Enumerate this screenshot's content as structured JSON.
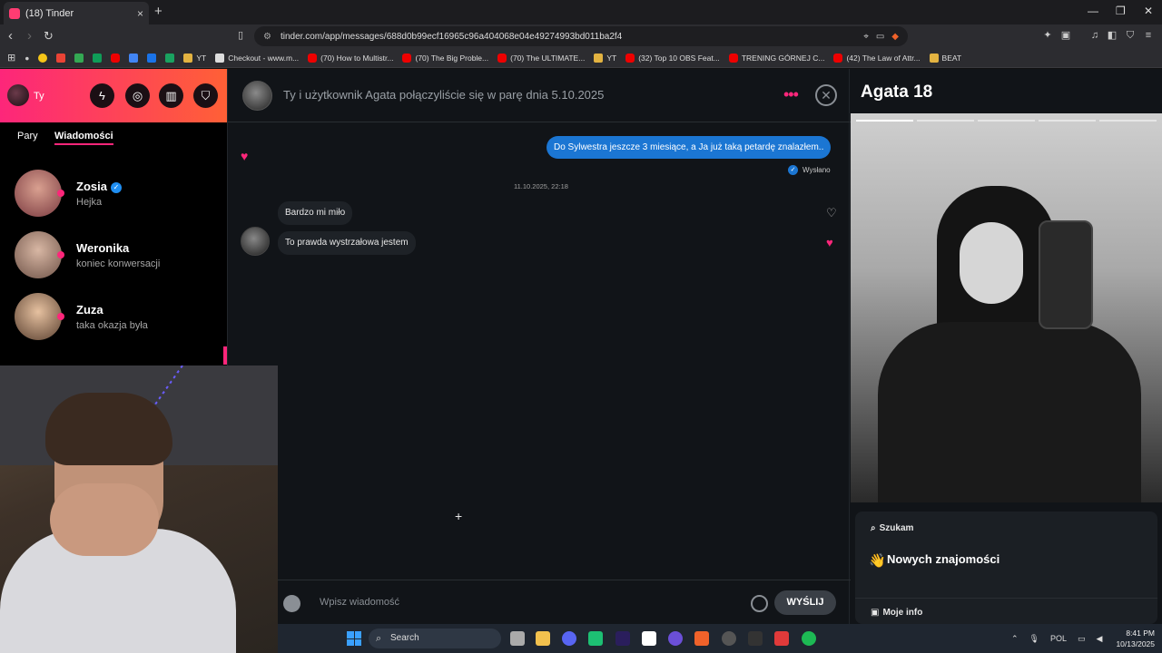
{
  "browser": {
    "tab_title": "(18) Tinder",
    "tab_close": "×",
    "new_tab": "+",
    "url": "tinder.com/app/messages/688d0b99ecf16965c96a404068e04e49274993bd011ba2f4",
    "bookmarks": [
      {
        "label": "YT",
        "icon": "folder"
      },
      {
        "label": "Checkout - www.m...",
        "icon": "page"
      },
      {
        "label": "(70) How to Multistr...",
        "icon": "youtube"
      },
      {
        "label": "(70) The Big Proble...",
        "icon": "youtube"
      },
      {
        "label": "(70) The ULTIMATE...",
        "icon": "youtube"
      },
      {
        "label": "YT",
        "icon": "folder"
      },
      {
        "label": "(32) Top 10 OBS Feat...",
        "icon": "youtube"
      },
      {
        "label": "TRENING GÓRNEJ C...",
        "icon": "youtube"
      },
      {
        "label": "(42) The Law of Attr...",
        "icon": "youtube"
      },
      {
        "label": "BEAT",
        "icon": "folder"
      }
    ]
  },
  "sidebar": {
    "me_label": "Ty",
    "tabs": {
      "matches": "Pary",
      "messages": "Wiadomości"
    },
    "conversations": [
      {
        "name": "Zosia",
        "preview": "Hejka",
        "verified": true
      },
      {
        "name": "Weronika",
        "preview": "koniec konwersacji",
        "verified": false
      },
      {
        "name": "Zuza",
        "preview": "taka okazja była",
        "verified": false
      }
    ]
  },
  "chat": {
    "header": "Ty i użytkownik Agata połączyliście się w parę dnia 5.10.2025",
    "messages": {
      "outgoing": "Do Sylwestra jeszcze 3 miesiące, a Ja już taką petardę znalazłem..",
      "sent_status": "Wysłano",
      "timestamp": "11.10.2025, 22:18",
      "incoming_1": "Bardzo mi miło",
      "incoming_2": "To prawda wystrzałowa jestem"
    },
    "composer": {
      "placeholder": "Wpisz wiadomość",
      "send_label": "WYŚLIJ"
    }
  },
  "profile": {
    "name": "Agata 18",
    "looking_for_label": "Szukam",
    "looking_for_value": "Nowych znajomości",
    "my_info_label": "Moje info"
  },
  "taskbar": {
    "search_label": "Search",
    "language": "POL",
    "time": "8:41 PM",
    "date": "10/13/2025"
  },
  "colors": {
    "brand_gradient_start": "#fd267a",
    "brand_gradient_end": "#ff6036",
    "outgoing_bubble": "#1b76d3"
  }
}
